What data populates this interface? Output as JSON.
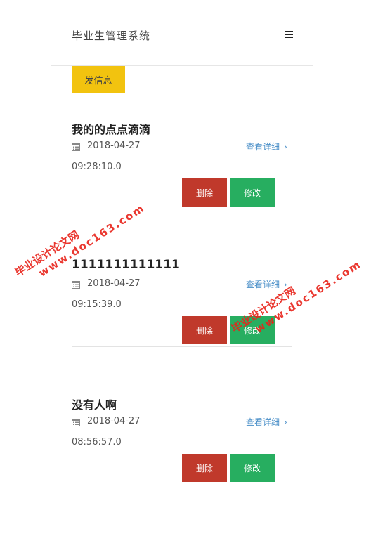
{
  "header": {
    "title": "毕业生管理系统",
    "menu_icon": "hamburger-menu-icon"
  },
  "actions": {
    "send_label": "发信息"
  },
  "messages": [
    {
      "title": "我的的点点滴滴",
      "date": "2018-04-27",
      "time": "09:28:10.0",
      "view_label": "查看详细",
      "delete_label": "删除",
      "edit_label": "修改"
    },
    {
      "title": "1111111111111",
      "date": "2018-04-27",
      "time": "09:15:39.0",
      "view_label": "查看详细",
      "delete_label": "删除",
      "edit_label": "修改"
    },
    {
      "title": "没有人啊",
      "date": "2018-04-27",
      "time": "08:56:57.0",
      "view_label": "查看详细",
      "delete_label": "删除",
      "edit_label": "修改"
    }
  ],
  "watermarks": [
    {
      "line1": "毕业设计论文网",
      "line2": "www.doc163.com"
    },
    {
      "line1": "毕业设计论文网",
      "line2": "www.doc163.com"
    }
  ],
  "colors": {
    "accent_yellow": "#f2c30f",
    "delete_red": "#c0392b",
    "edit_green": "#27ae60",
    "link_blue": "#4a8fc8",
    "watermark_red": "#e8231a"
  }
}
